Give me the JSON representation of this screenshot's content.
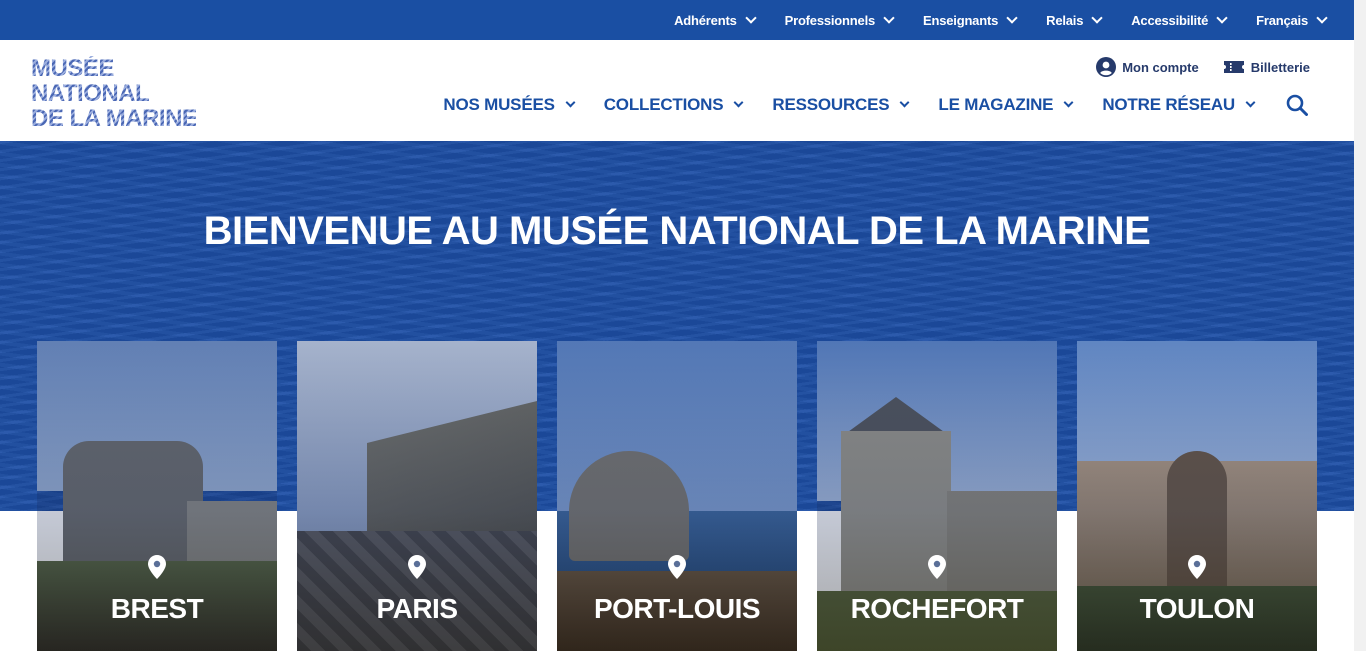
{
  "topbar": {
    "items": [
      {
        "label": "Adhérents"
      },
      {
        "label": "Professionnels"
      },
      {
        "label": "Enseignants"
      },
      {
        "label": "Relais"
      },
      {
        "label": "Accessibilité"
      },
      {
        "label": "Français"
      }
    ]
  },
  "logo": {
    "line1": "MUSÉE",
    "line2": "NATIONAL",
    "line3": "DE LA MARINE"
  },
  "account": {
    "account_label": "Mon compte",
    "ticket_label": "Billetterie"
  },
  "nav": {
    "items": [
      {
        "label": "NOS MUSÉES"
      },
      {
        "label": "COLLECTIONS"
      },
      {
        "label": "RESSOURCES"
      },
      {
        "label": "LE MAGAZINE"
      },
      {
        "label": "NOTRE RÉSEAU"
      }
    ],
    "search_icon": "search-icon"
  },
  "hero": {
    "title": "BIENVENUE AU MUSÉE NATIONAL DE LA MARINE"
  },
  "cards": [
    {
      "name": "BREST"
    },
    {
      "name": "PARIS"
    },
    {
      "name": "PORT-LOUIS"
    },
    {
      "name": "ROCHEFORT"
    },
    {
      "name": "TOULON"
    }
  ],
  "colors": {
    "brand_blue": "#1a4fa3",
    "nav_text": "#1a4fa3",
    "logo": "#6f86c4"
  }
}
